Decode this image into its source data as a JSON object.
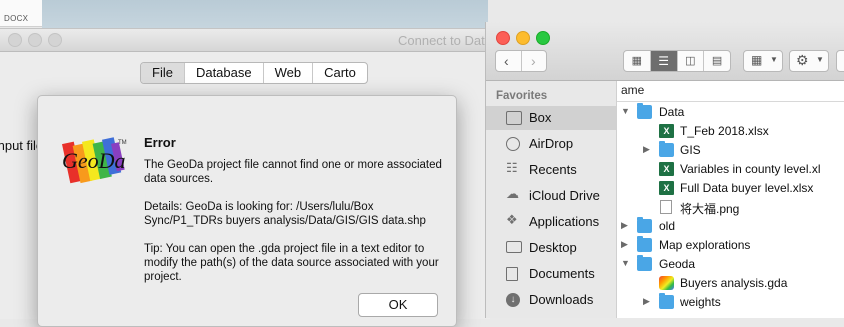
{
  "docx_chip": {
    "label": "DOCX"
  },
  "geoda": {
    "window_title": "Connect to Data Source",
    "tabs": [
      "File",
      "Database",
      "Web",
      "Carto"
    ],
    "input_file_label": "Input file"
  },
  "error_dialog": {
    "logo_text": "GeoDa",
    "logo_tm": "TM",
    "title": "Error",
    "message_1": "The GeoDa project file cannot find one or more associated data sources.",
    "message_2": "Details: GeoDa is looking for: /Users/lulu/Box Sync/P1_TDRs buyers analysis/Data/GIS/GIS data.shp",
    "message_3": "Tip: You can open the .gda project file in a text editor to modify the path(s) of the data source associated with your project.",
    "ok_label": "OK"
  },
  "finder": {
    "sidebar_heading": "Favorites",
    "sidebar_items": [
      {
        "label": "Box",
        "icon": "folder-icon",
        "selected": true
      },
      {
        "label": "AirDrop",
        "icon": "airdrop-icon"
      },
      {
        "label": "Recents",
        "icon": "clock-icon"
      },
      {
        "label": "iCloud Drive",
        "icon": "cloud-icon"
      },
      {
        "label": "Applications",
        "icon": "applications-icon"
      },
      {
        "label": "Desktop",
        "icon": "desktop-icon"
      },
      {
        "label": "Documents",
        "icon": "documents-icon"
      },
      {
        "label": "Downloads",
        "icon": "download-icon"
      }
    ],
    "column_header": "ame",
    "files": [
      {
        "name": "Data",
        "type": "folder",
        "depth": 0,
        "expanded": true
      },
      {
        "name": "T_Feb 2018.xlsx",
        "type": "xlsx",
        "depth": 1
      },
      {
        "name": "GIS",
        "type": "folder",
        "depth": 1,
        "expanded": false
      },
      {
        "name": "Variables in county level.xl",
        "type": "xlsx",
        "depth": 1
      },
      {
        "name": "Full Data buyer level.xlsx",
        "type": "xlsx",
        "depth": 1
      },
      {
        "name": "将大福.png",
        "type": "png",
        "depth": 1
      },
      {
        "name": "old",
        "type": "folder",
        "depth": 0,
        "expanded": false
      },
      {
        "name": "Map explorations",
        "type": "folder",
        "depth": 0,
        "expanded": false
      },
      {
        "name": "Geoda",
        "type": "folder",
        "depth": 0,
        "expanded": true
      },
      {
        "name": "Buyers analysis.gda",
        "type": "gda",
        "depth": 1
      },
      {
        "name": "weights",
        "type": "folder",
        "depth": 1,
        "expanded": false
      }
    ],
    "colors": {
      "close": "#fc5f57",
      "minimize": "#fdbc2e",
      "zoom": "#28c840",
      "folder": "#4aa6e6",
      "excel": "#1e7144"
    }
  }
}
